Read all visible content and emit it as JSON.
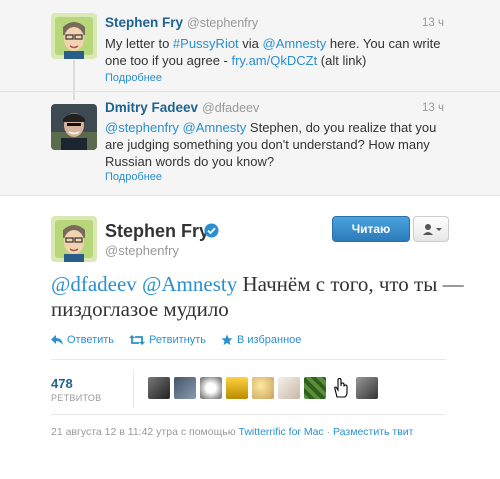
{
  "conversation": [
    {
      "name": "Stephen Fry",
      "handle": "@stephenfry",
      "time": "13 ч",
      "text_parts": [
        "My letter to ",
        "#PussyRiot",
        " via ",
        "@Amnesty",
        " here. You can write one too if you agree - ",
        "fry.am/QkDCZt",
        " (alt link)"
      ],
      "more": "Подробнее"
    },
    {
      "name": "Dmitry Fadeev",
      "handle": "@dfadeev",
      "time": "13 ч",
      "text_parts": [
        "@stephenfry",
        " ",
        "@Amnesty",
        " Stephen, do you realize that you are judging something you don't understand? How many Russian words do you know?"
      ],
      "more": "Подробнее"
    }
  ],
  "main": {
    "name": "Stephen Fry",
    "handle": "@stephenfry",
    "follow_label": "Читаю",
    "text_parts": [
      "@dfadeev",
      " ",
      "@Amnesty",
      " Начнём с того, что ты — пиздоглазое мудило"
    ],
    "actions": {
      "reply": "Ответить",
      "retweet": "Ретвитнуть",
      "favorite": "В избранное"
    },
    "stats": {
      "retweets": "478",
      "retweets_label": "РЕТВИТОВ"
    },
    "footer": {
      "timestamp": "21 августа 12 в 11:42 утра с помощью",
      "client": "Twitterrific for Mac",
      "separator": "·",
      "embed": "Разместить твит"
    }
  },
  "colors": {
    "link": "#2a8fd0",
    "name": "#1e6391",
    "muted": "#999999",
    "button": "#2b7bb9"
  }
}
